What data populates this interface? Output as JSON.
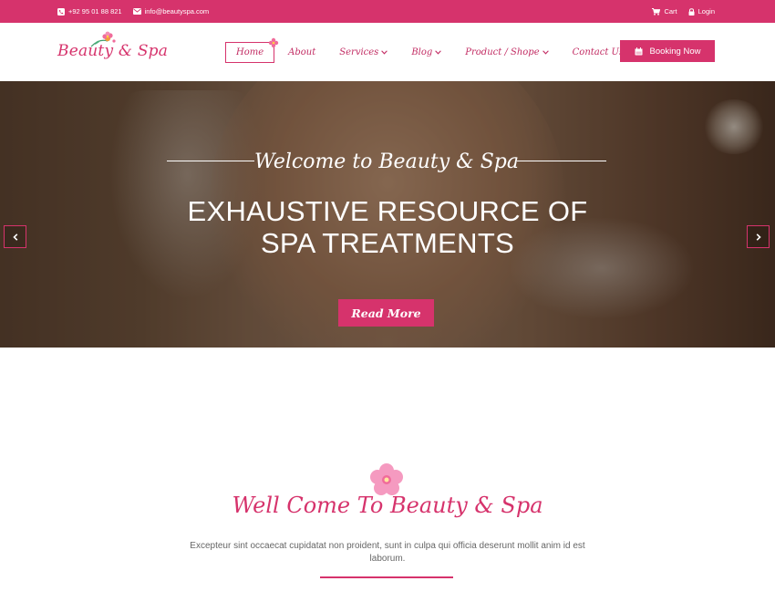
{
  "topbar": {
    "phone": "+92 95 01 88 821",
    "email": "info@beautyspa.com",
    "cart_label": "Cart",
    "login_label": "Login"
  },
  "header": {
    "logo_text": "Beauty & Spa",
    "nav": [
      {
        "label": "Home"
      },
      {
        "label": "About"
      },
      {
        "label": "Services"
      },
      {
        "label": "Blog"
      },
      {
        "label": "Product / Shope"
      },
      {
        "label": "Contact Us"
      }
    ],
    "booking_label": "Booking Now"
  },
  "hero": {
    "title": "Welcome to Beauty & Spa",
    "heading_line1": "EXHAUSTIVE RESOURCE OF",
    "heading_line2": "SPA TREATMENTS",
    "button_label": "Read More"
  },
  "welcome": {
    "title": "Well Come To Beauty & Spa",
    "text": "Excepteur sint occaecat cupidatat non proident, sunt in culpa qui officia deserunt mollit anim id est laborum."
  },
  "colors": {
    "accent": "#d6336c",
    "topbar": "#d6336c",
    "text": "#666666"
  },
  "icons": [
    "phone-icon",
    "envelope-icon",
    "cart-icon",
    "lock-icon",
    "calendar-icon",
    "chevron-down-icon",
    "chevron-left-icon",
    "chevron-right-icon",
    "flower-icon"
  ]
}
